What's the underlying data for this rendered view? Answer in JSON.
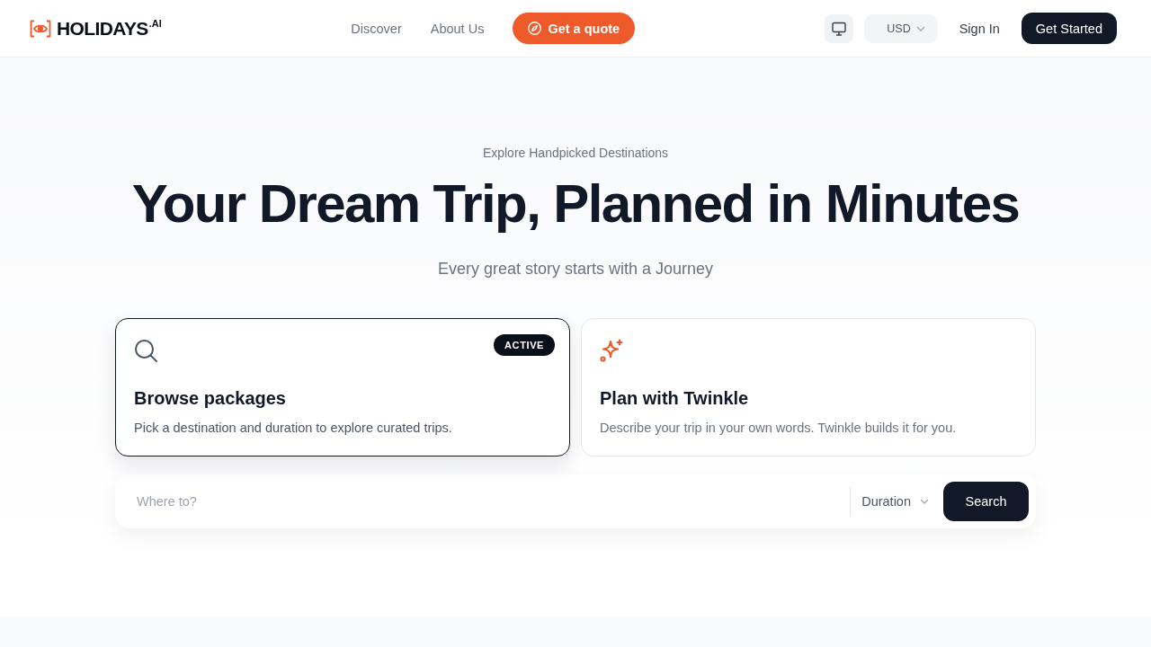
{
  "nav": {
    "logo": "HOLIDAYS$^{.AI}$",
    "links": [
      "Discover",
      "About Us"
    ],
    "quote_button": "Get a quote",
    "currency": "USD",
    "sign_in": "Sign In",
    "get_started": "Get Started"
  },
  "hero": {
    "eyebrow": "Explore Handpicked Destinations",
    "title": "Your Dream Trip, Planned in Minutes",
    "subtitle": "Every great story starts with a Journey"
  },
  "modes": [
    {
      "kind": "search",
      "title": "Browse packages",
      "description": "Pick a destination and duration to explore curated trips.",
      "selected": true,
      "badge": "ACTIVE"
    },
    {
      "kind": "sparkle",
      "title": "Plan with Twinkle",
      "description": "Describe your trip in your own words. Twinkle builds it for you.",
      "selected": false
    }
  ],
  "search_bar": {
    "placeholder": "Where to?",
    "duration": "Duration",
    "button": "Search"
  }
}
